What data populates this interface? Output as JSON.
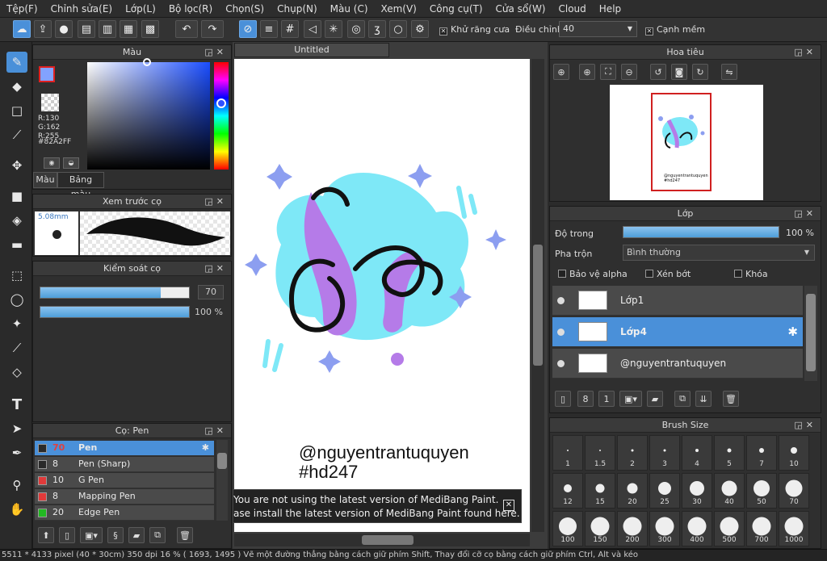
{
  "menu": [
    "Tệp(F)",
    "Chỉnh sửa(E)",
    "Lớp(L)",
    "Bộ lọc(R)",
    "Chọn(S)",
    "Chụp(N)",
    "Màu (C)",
    "Xem(V)",
    "Công cụ(T)",
    "Cửa sổ(W)",
    "Cloud",
    "Help"
  ],
  "toolbar": {
    "antialias_label": "Khử răng cưa",
    "adjust_label": "Điều chỉnh",
    "adjust_value": "40",
    "smooth_label": "Cạnh mềm"
  },
  "color_panel": {
    "title": "Màu",
    "rgb": "R:130\nG:162\nR:255",
    "hex": "#82A2FF",
    "tab_color": "Màu",
    "tab_palette": "Bảng màu",
    "primary_color": "#82A2FF"
  },
  "brush_preview": {
    "title": "Xem trước cọ",
    "size": "5.08mm"
  },
  "brush_control": {
    "title": "Kiểm soát cọ",
    "size_value": "70",
    "size_fraction": 0.81,
    "opacity_value": "100 %",
    "opacity_fraction": 1.0
  },
  "brush_list": {
    "title": "Cọ: Pen",
    "items": [
      {
        "size": "70",
        "name": "Pen",
        "color": "#2a2a2a",
        "selected": true
      },
      {
        "size": "8",
        "name": "Pen (Sharp)",
        "color": "#2a2a2a",
        "selected": false
      },
      {
        "size": "10",
        "name": "G Pen",
        "color": "#e03a3a",
        "selected": false
      },
      {
        "size": "8",
        "name": "Mapping Pen",
        "color": "#e03a3a",
        "selected": false
      },
      {
        "size": "20",
        "name": "Edge Pen",
        "color": "#22b822",
        "selected": false
      }
    ]
  },
  "canvas": {
    "tab_title": "Untitled",
    "signature_line1": "@nguyentrantuquyen",
    "signature_line2": "#hd247"
  },
  "notification": {
    "line1": "You are not using the latest version of MediBang Paint.",
    "line2": "ase install the latest version of MediBang Paint found here."
  },
  "navigator": {
    "title": "Hoa tiêu",
    "thumb_line1": "@nguyentrantuquyen",
    "thumb_line2": "#hd247"
  },
  "layers": {
    "title": "Lớp",
    "opacity_label": "Độ trong",
    "opacity_value": "100 %",
    "opacity_fraction": 1.0,
    "blend_label": "Pha trộn",
    "blend_value": "Bình thường",
    "protect_alpha": "Bảo vệ alpha",
    "clipping": "Xén bớt",
    "lock": "Khóa",
    "items": [
      {
        "name": "Lớp1",
        "selected": false
      },
      {
        "name": "Lớp4",
        "selected": true
      },
      {
        "name": "@nguyentrantuquyen",
        "selected": false
      }
    ]
  },
  "brush_size": {
    "title": "Brush Size",
    "row1": [
      "1",
      "1.5",
      "2",
      "3",
      "4",
      "5",
      "7",
      "10"
    ],
    "row2": [
      "12",
      "15",
      "20",
      "25",
      "30",
      "40",
      "50",
      "70"
    ],
    "row3": [
      "100",
      "150",
      "200",
      "300",
      "400",
      "500",
      "700",
      "1000"
    ]
  },
  "status": {
    "text": "5511 * 4133 pixel  (40 * 30cm)  350 dpi  16 %  ( 1693, 1495 )  Vẽ một đường thẳng bằng cách giữ phím Shift, Thay đổi cỡ cọ bằng cách giữ phím Ctrl, Alt và kéo"
  },
  "colors": {
    "accent": "#4a90d9",
    "blob": "#7ee8f7",
    "purple": "#b57be8",
    "star": "#8c9ef0"
  }
}
